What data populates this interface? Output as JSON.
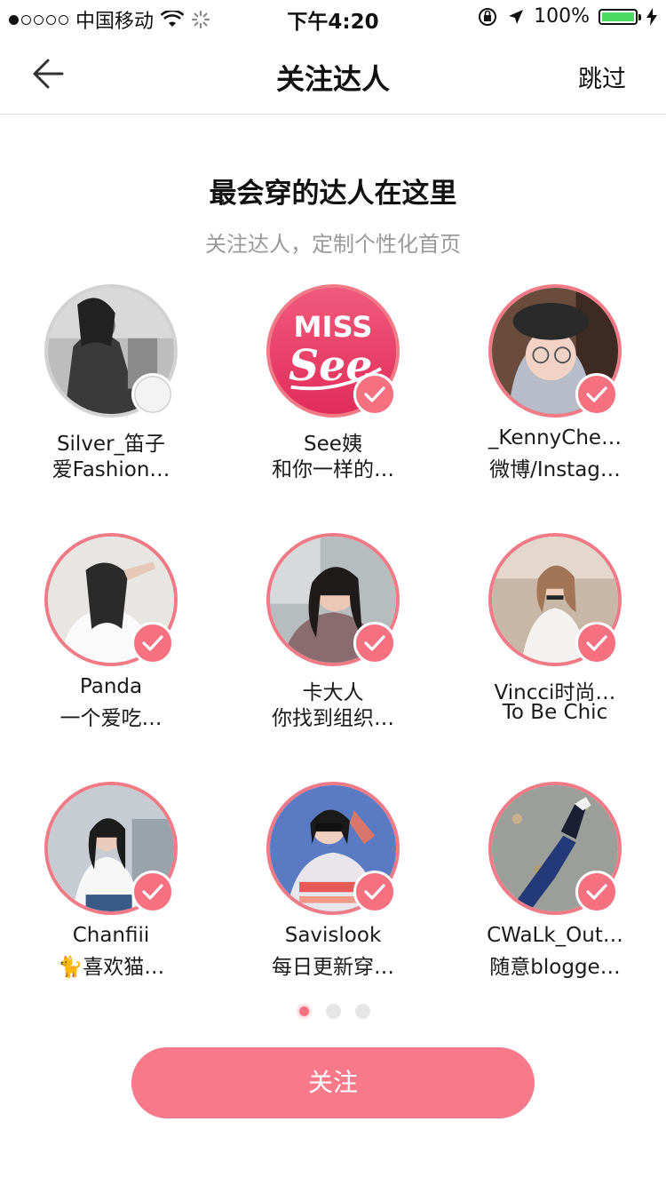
{
  "status_bar": {
    "carrier": "中国移动",
    "time": "下午4:20",
    "battery": "100%",
    "battery_level": 1.0
  },
  "nav": {
    "title": "关注达人",
    "skip_label": "跳过",
    "back_icon": "arrow-left-icon"
  },
  "headline": "最会穿的达人在这里",
  "subheadline": "关注达人，定制个性化首页",
  "bloggers": [
    {
      "name": "Silver_笛子",
      "desc": "爱Fashion…",
      "selected": false
    },
    {
      "name": "See姨",
      "desc": "和你一样的…",
      "selected": true,
      "logo_text_1": "MISS",
      "logo_text_2": "See"
    },
    {
      "name": "_KennyChe…",
      "desc": "微博/Instag…",
      "selected": true
    },
    {
      "name": "Panda",
      "desc": "一个爱吃…",
      "selected": true
    },
    {
      "name": "卡大人",
      "desc": "你找到组织…",
      "selected": true
    },
    {
      "name": "Vincci时尚…",
      "desc": "To Be Chic",
      "selected": true
    },
    {
      "name": "Chanfiii",
      "desc": "🐈喜欢猫…",
      "selected": true
    },
    {
      "name": "Savislook",
      "desc": "每日更新穿…",
      "selected": true
    },
    {
      "name": "CWaLk_Out…",
      "desc": "随意blogge…",
      "selected": true
    }
  ],
  "pagination": {
    "pages": 3,
    "current": 1
  },
  "follow_button": "关注",
  "colors": {
    "accent": "#f8798a",
    "check": "#f5717f",
    "ring": "#f07a86"
  }
}
